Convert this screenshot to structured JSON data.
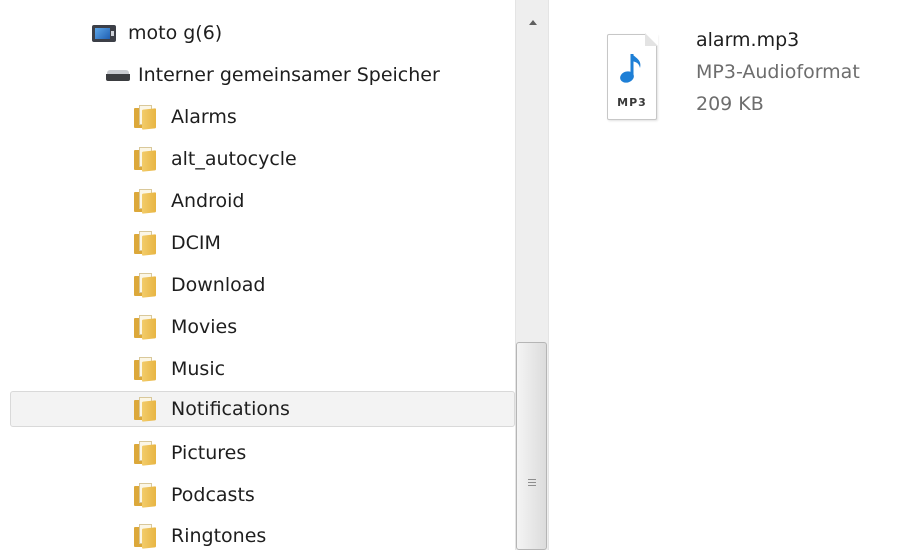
{
  "nav": {
    "device": {
      "label": "moto g(6)",
      "icon": "phone-icon"
    },
    "storage": {
      "label": "Interner gemeinsamer Speicher",
      "icon": "drive-icon"
    },
    "folders": [
      {
        "label": "Alarms",
        "icon": "folder-icon",
        "selected": false
      },
      {
        "label": "alt_autocycle",
        "icon": "folder-icon",
        "selected": false
      },
      {
        "label": "Android",
        "icon": "folder-icon",
        "selected": false
      },
      {
        "label": "DCIM",
        "icon": "folder-icon",
        "selected": false
      },
      {
        "label": "Download",
        "icon": "folder-icon",
        "selected": false
      },
      {
        "label": "Movies",
        "icon": "folder-icon",
        "selected": false
      },
      {
        "label": "Music",
        "icon": "folder-icon",
        "selected": false
      },
      {
        "label": "Notifications",
        "icon": "folder-icon",
        "selected": true
      },
      {
        "label": "Pictures",
        "icon": "folder-icon",
        "selected": false
      },
      {
        "label": "Podcasts",
        "icon": "folder-icon",
        "selected": false
      },
      {
        "label": "Ringtones",
        "icon": "folder-icon",
        "selected": false
      }
    ]
  },
  "content": {
    "file": {
      "name": "alarm.mp3",
      "type": "MP3-Audioformat",
      "size": "209 KB",
      "icon_label": "MP3",
      "icon": "mp3-file-icon"
    }
  },
  "colors": {
    "selection_bg": "#f3f3f3",
    "selection_border": "#d9d9d9",
    "folder": "#e8b543",
    "note": "#1e7fd6"
  }
}
